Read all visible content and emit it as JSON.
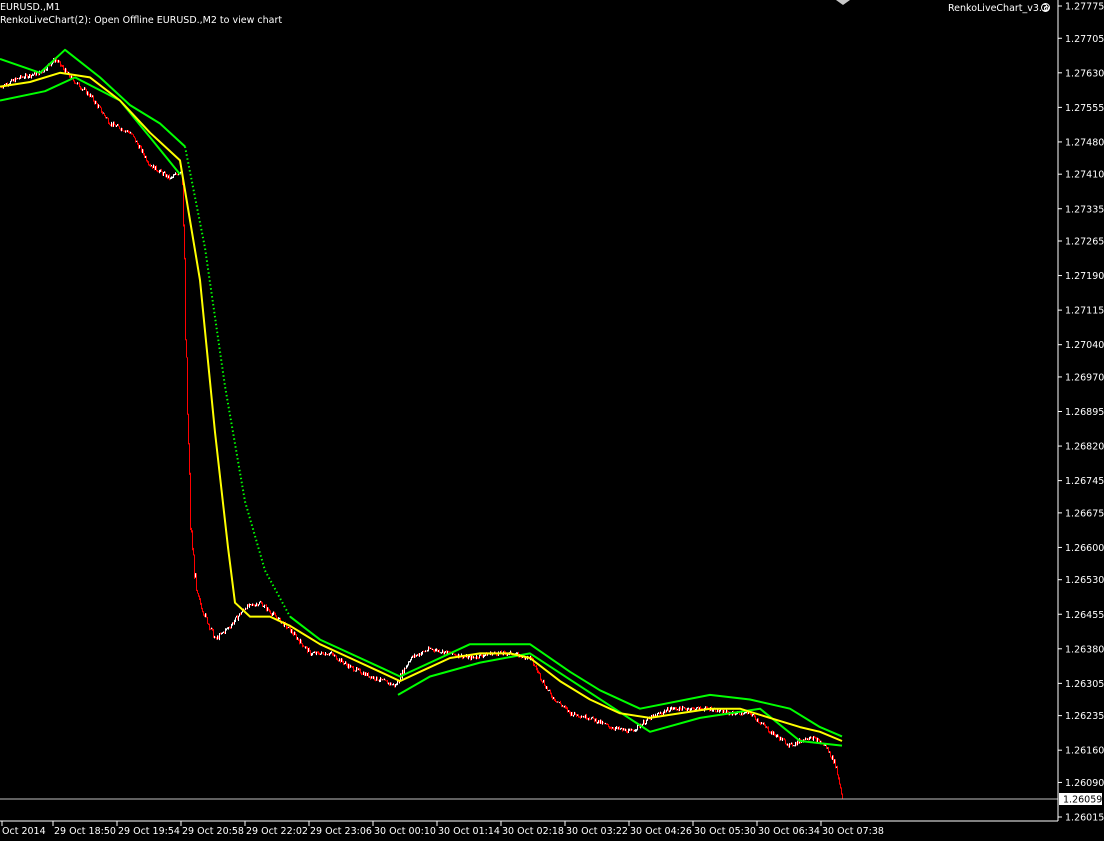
{
  "window": {
    "symbol_label": "EURUSD.,M1",
    "info_label": "RenkoLiveChart(2): Open Offline EURUSD.,M2 to view chart",
    "indicator_name": "RenkoLiveChart_v3.3"
  },
  "colors": {
    "background": "#000000",
    "foreground": "#ffffff",
    "bull_candle": "#ffffff",
    "bear_candle": "#ff0000",
    "moving_average": "#ffff00",
    "band": "#00ff00",
    "bid_line": "#c0c0c0"
  },
  "icons": {
    "settings": "gear-icon",
    "collapse": "chevron-down-icon"
  },
  "chart_data": {
    "type": "candlestick",
    "y_axis": {
      "ticks": [
        "1.27775",
        "1.27705",
        "1.27630",
        "1.27555",
        "1.27480",
        "1.27410",
        "1.27335",
        "1.27265",
        "1.27190",
        "1.27115",
        "1.27040",
        "1.26970",
        "1.26895",
        "1.26820",
        "1.26745",
        "1.26675",
        "1.26600",
        "1.26530",
        "1.26455",
        "1.26380",
        "1.26305",
        "1.26235",
        "1.26160",
        "1.26090",
        "1.26015"
      ],
      "min": 1.26015,
      "max": 1.27775
    },
    "x_axis": {
      "ticks": [
        "Oct 2014",
        "29 Oct 18:50",
        "29 Oct 19:54",
        "29 Oct 20:58",
        "29 Oct 22:02",
        "29 Oct 23:06",
        "30 Oct 00:10",
        "30 Oct 01:14",
        "30 Oct 02:18",
        "30 Oct 03:22",
        "30 Oct 04:26",
        "30 Oct 05:30",
        "30 Oct 06:34",
        "30 Oct 07:38"
      ]
    },
    "current_price": "1.26059",
    "price_path": [
      [
        0,
        1.276
      ],
      [
        20,
        1.2762
      ],
      [
        40,
        1.2763
      ],
      [
        55,
        1.2766
      ],
      [
        70,
        1.2762
      ],
      [
        90,
        1.2758
      ],
      [
        110,
        1.2752
      ],
      [
        130,
        1.275
      ],
      [
        150,
        1.2743
      ],
      [
        170,
        1.274
      ],
      [
        182,
        1.2742
      ],
      [
        185,
        1.2705
      ],
      [
        190,
        1.2665
      ],
      [
        196,
        1.265
      ],
      [
        205,
        1.2645
      ],
      [
        215,
        1.264
      ],
      [
        230,
        1.2643
      ],
      [
        245,
        1.2647
      ],
      [
        260,
        1.2648
      ],
      [
        275,
        1.2645
      ],
      [
        290,
        1.2642
      ],
      [
        310,
        1.2637
      ],
      [
        330,
        1.2637
      ],
      [
        350,
        1.2634
      ],
      [
        370,
        1.2632
      ],
      [
        395,
        1.263
      ],
      [
        410,
        1.2636
      ],
      [
        430,
        1.2638
      ],
      [
        450,
        1.2637
      ],
      [
        470,
        1.2636
      ],
      [
        490,
        1.2637
      ],
      [
        510,
        1.2637
      ],
      [
        530,
        1.2636
      ],
      [
        550,
        1.2628
      ],
      [
        570,
        1.2624
      ],
      [
        590,
        1.2623
      ],
      [
        610,
        1.2621
      ],
      [
        630,
        1.262
      ],
      [
        650,
        1.2623
      ],
      [
        670,
        1.2625
      ],
      [
        690,
        1.2625
      ],
      [
        710,
        1.2625
      ],
      [
        730,
        1.2624
      ],
      [
        750,
        1.2624
      ],
      [
        770,
        1.262
      ],
      [
        790,
        1.2617
      ],
      [
        810,
        1.2619
      ],
      [
        825,
        1.2617
      ],
      [
        835,
        1.2613
      ],
      [
        842,
        1.2606
      ]
    ],
    "moving_average": [
      [
        0,
        1.276
      ],
      [
        30,
        1.2761
      ],
      [
        60,
        1.2763
      ],
      [
        90,
        1.2762
      ],
      [
        120,
        1.2757
      ],
      [
        150,
        1.275
      ],
      [
        180,
        1.2744
      ],
      [
        200,
        1.2718
      ],
      [
        215,
        1.2685
      ],
      [
        228,
        1.266
      ],
      [
        235,
        1.2648
      ],
      [
        250,
        1.2645
      ],
      [
        270,
        1.2645
      ],
      [
        290,
        1.2643
      ],
      [
        320,
        1.2639
      ],
      [
        350,
        1.2636
      ],
      [
        380,
        1.2633
      ],
      [
        400,
        1.2631
      ],
      [
        420,
        1.2633
      ],
      [
        450,
        1.2636
      ],
      [
        480,
        1.2637
      ],
      [
        510,
        1.2637
      ],
      [
        530,
        1.2636
      ],
      [
        560,
        1.2631
      ],
      [
        590,
        1.2627
      ],
      [
        620,
        1.2624
      ],
      [
        650,
        1.2623
      ],
      [
        680,
        1.2624
      ],
      [
        710,
        1.2625
      ],
      [
        740,
        1.2625
      ],
      [
        770,
        1.2623
      ],
      [
        800,
        1.2621
      ],
      [
        820,
        1.262
      ],
      [
        842,
        1.2618
      ]
    ],
    "upper_band": [
      [
        0,
        1.2766
      ],
      [
        40,
        1.2763
      ],
      [
        65,
        1.2768
      ],
      [
        100,
        1.2762
      ],
      [
        130,
        1.2756
      ],
      [
        160,
        1.2752
      ],
      [
        185,
        1.2747
      ],
      [
        205,
        1.2725
      ],
      [
        225,
        1.2695
      ],
      [
        245,
        1.267
      ],
      [
        265,
        1.2655
      ],
      [
        290,
        1.2645
      ],
      [
        320,
        1.264
      ],
      [
        350,
        1.2637
      ],
      [
        380,
        1.2634
      ],
      [
        400,
        1.2632
      ],
      [
        470,
        1.2639
      ],
      [
        530,
        1.2639
      ],
      [
        570,
        1.2633
      ],
      [
        600,
        1.2629
      ],
      [
        640,
        1.2625
      ],
      [
        710,
        1.2628
      ],
      [
        750,
        1.2627
      ],
      [
        790,
        1.2625
      ],
      [
        820,
        1.2621
      ],
      [
        842,
        1.2619
      ]
    ],
    "lower_band": [
      [
        0,
        1.2757
      ],
      [
        45,
        1.2759
      ],
      [
        75,
        1.2762
      ],
      [
        120,
        1.2757
      ],
      [
        150,
        1.2749
      ],
      [
        180,
        1.2741
      ],
      [
        398,
        1.2628
      ],
      [
        430,
        1.2632
      ],
      [
        480,
        1.2635
      ],
      [
        530,
        1.2637
      ],
      [
        650,
        1.262
      ],
      [
        700,
        1.2623
      ],
      [
        760,
        1.2625
      ],
      [
        800,
        1.2618
      ],
      [
        842,
        1.2617
      ]
    ]
  }
}
